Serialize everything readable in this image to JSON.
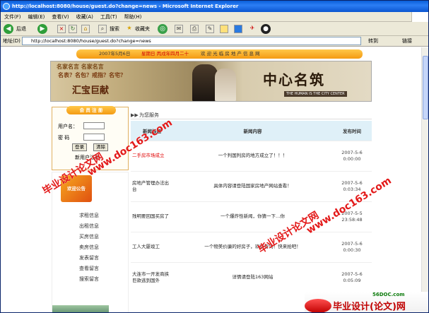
{
  "window": {
    "title": "http://localhost:8080/house/guest.do?change=news - Microsoft Internet Explorer"
  },
  "menu": [
    "文件(F)",
    "编辑(E)",
    "查看(V)",
    "收藏(A)",
    "工具(T)",
    "帮助(H)"
  ],
  "toolbar": {
    "back": "后退",
    "search": "搜索",
    "favorites": "收藏夹"
  },
  "address": {
    "label": "地址(D)",
    "url": "http://localhost:8080/house/guest.do?change=news",
    "go": "转到",
    "links": "链接"
  },
  "site": {
    "date": "2007年5月6日",
    "weekday": "星期日 丙戌年四月二十",
    "welcome": "欢 迎 光 临 房 地 产 信 息 网"
  },
  "banner": {
    "line1": "名家名言 名家名言",
    "line2": "名表？名包？戒指？名宅？",
    "line3": "汇宝巨献",
    "headline": "中心名筑",
    "tagline": "THE HUMAN IS THE CITY CENTER"
  },
  "login": {
    "title": "会 员 注 册",
    "user_label": "用户名：",
    "pass_label": "密 码",
    "login_btn": "登录",
    "clear_btn": "清除",
    "register": "新用户注册"
  },
  "sidebar_menu": {
    "emblem": "欢迎公告",
    "items": [
      "求租信息",
      "出租信息",
      "买房信息",
      "卖房信息",
      "发表留言",
      "查看留言",
      "搜索留言"
    ]
  },
  "section": {
    "title": "为您服务"
  },
  "news_table": {
    "headers": [
      "新闻标题",
      "新闻内容",
      "发布时间"
    ],
    "rows": [
      {
        "title": "二手房市场成立",
        "content": "一个判国判房的地方成立了！！！",
        "date": "2007-5-6",
        "time": "0:00:00"
      },
      {
        "title": "房地产管理办法出台",
        "content": "具体内容请登陆国家房地产网站查看！",
        "date": "2007-5-6",
        "time": "0:03:34"
      },
      {
        "title": "残明要回国买房了",
        "content": "一个爆炸性新闻，你猜一下…你",
        "date": "2007-5-5",
        "time": "23:58:48"
      },
      {
        "title": "工人大厦竣工",
        "content": "一个物美价廉的好房子，欢迎咨询！快来抢吧！",
        "date": "2007-5-6",
        "time": "0:00:30"
      },
      {
        "title": "大连市一开发商挟巨款逃到国外",
        "content": "详情请登陆163网站",
        "date": "2007-5-6",
        "time": "0:05:09"
      }
    ]
  },
  "watermarks": {
    "text1": "毕业设计论文网",
    "text2": "www.doc163.com",
    "brand_site": "56DOC.com",
    "brand_text": "毕业设计(论文)网"
  },
  "colors": {
    "title_bar": "#0a5fd8",
    "orange_bar": "#f49a12",
    "header_bg": "#dff0f8",
    "red_link": "#e00000",
    "watermark": "#e31919"
  }
}
